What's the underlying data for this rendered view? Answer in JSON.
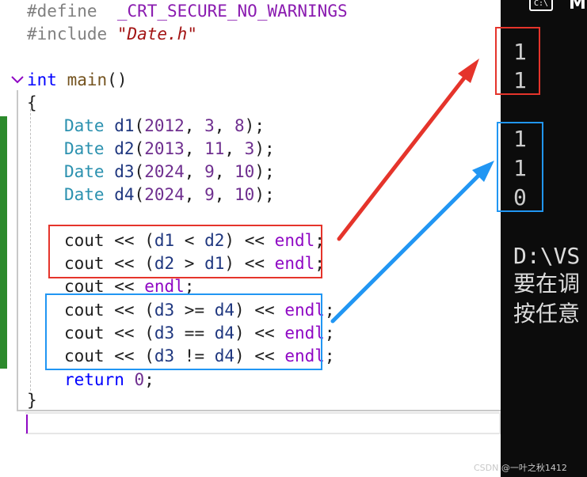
{
  "editor": {
    "line_define": {
      "directive": "#define",
      "macro": "_CRT_SECURE_NO_WARNINGS"
    },
    "line_include": {
      "directive": "#include",
      "file": "\"Date.h\""
    },
    "line_main": {
      "type": "int",
      "name": "main",
      "parens": "()"
    },
    "open_brace": "{",
    "close_brace": "}",
    "date_decls": [
      {
        "type": "Date",
        "var": "d1",
        "args": [
          "2012",
          "3",
          "8"
        ]
      },
      {
        "type": "Date",
        "var": "d2",
        "args": [
          "2013",
          "11",
          "3"
        ]
      },
      {
        "type": "Date",
        "var": "d3",
        "args": [
          "2024",
          "9",
          "10"
        ]
      },
      {
        "type": "Date",
        "var": "d4",
        "args": [
          "2024",
          "9",
          "10"
        ]
      }
    ],
    "couts": [
      {
        "lhs": "d1",
        "op": "<",
        "rhs": "d2"
      },
      {
        "lhs": "d2",
        "op": ">",
        "rhs": "d1"
      },
      {
        "plain": true
      },
      {
        "lhs": "d3",
        "op": ">=",
        "rhs": "d4"
      },
      {
        "lhs": "d3",
        "op": "==",
        "rhs": "d4"
      },
      {
        "lhs": "d3",
        "op": "!=",
        "rhs": "d4"
      }
    ],
    "tokens": {
      "cout": "cout",
      "shift": "<<",
      "endl": "endl",
      "semicolon": ";",
      "return_kw": "return",
      "return_val": "0"
    }
  },
  "console": {
    "title": "M",
    "icon_glyph": "C:\\",
    "output_group1": [
      "1",
      "1"
    ],
    "output_group2": [
      "1",
      "1",
      "0"
    ],
    "path_line": "D:\\VS",
    "message_line1": "要在调",
    "message_line2": "按任意"
  },
  "watermark": "CSDN @一叶之秋1412",
  "colors": {
    "red_highlight": "#e5342b",
    "blue_highlight": "#2196f3",
    "change_bar": "#2c8a2c",
    "console_bg": "#0c0c0c"
  }
}
